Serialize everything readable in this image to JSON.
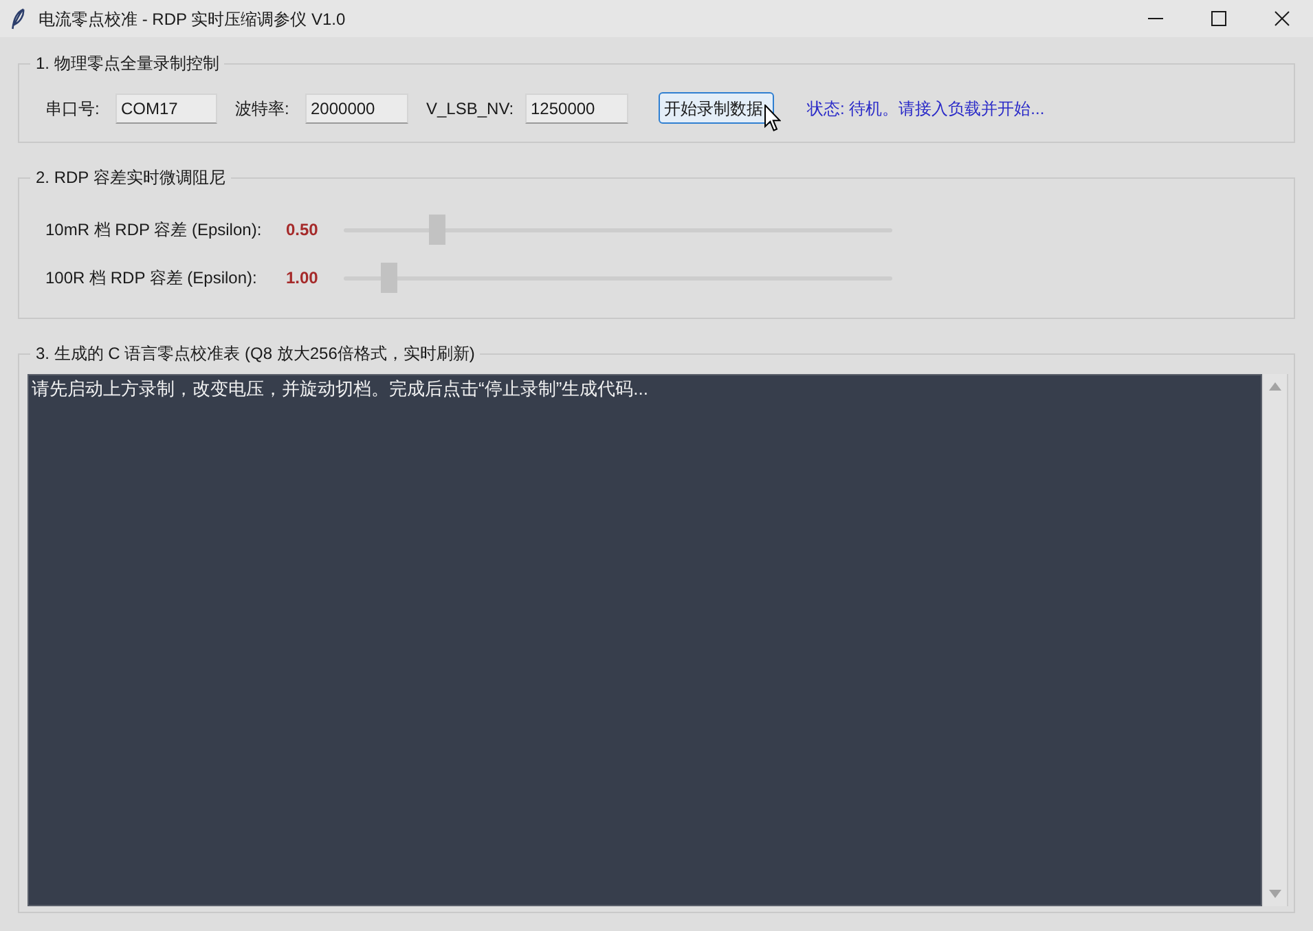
{
  "window": {
    "title": "电流零点校准 - RDP 实时压缩调参仪 V1.0"
  },
  "recording_group": {
    "title": "1. 物理零点全量录制控制",
    "fields": [
      {
        "label": "串口号:",
        "value": "COM17"
      },
      {
        "label": "波特率:",
        "value": "2000000"
      },
      {
        "label": "V_LSB_NV:",
        "value": "1250000"
      }
    ],
    "button": {
      "label": "开始录制数据",
      "focused": true
    },
    "status": "状态: 待机。请接入负载并开始..."
  },
  "tuning_group": {
    "title": "2. RDP 容差实时微调阻尼",
    "sliders": [
      {
        "label": "10mR 档 RDP 容差 (Epsilon):",
        "reading": "0.50",
        "level": 0.16
      },
      {
        "label": "100R 档 RDP 容差 (Epsilon):",
        "reading": "1.00",
        "level": 0.07
      }
    ]
  },
  "output_group": {
    "title": "3. 生成的 C 语言零点校准表 (Q8 放大256倍格式，实时刷新)",
    "text": "请先启动上方录制，改变电压，并旋动切档。完成后点击“停止录制”生成代码..."
  }
}
